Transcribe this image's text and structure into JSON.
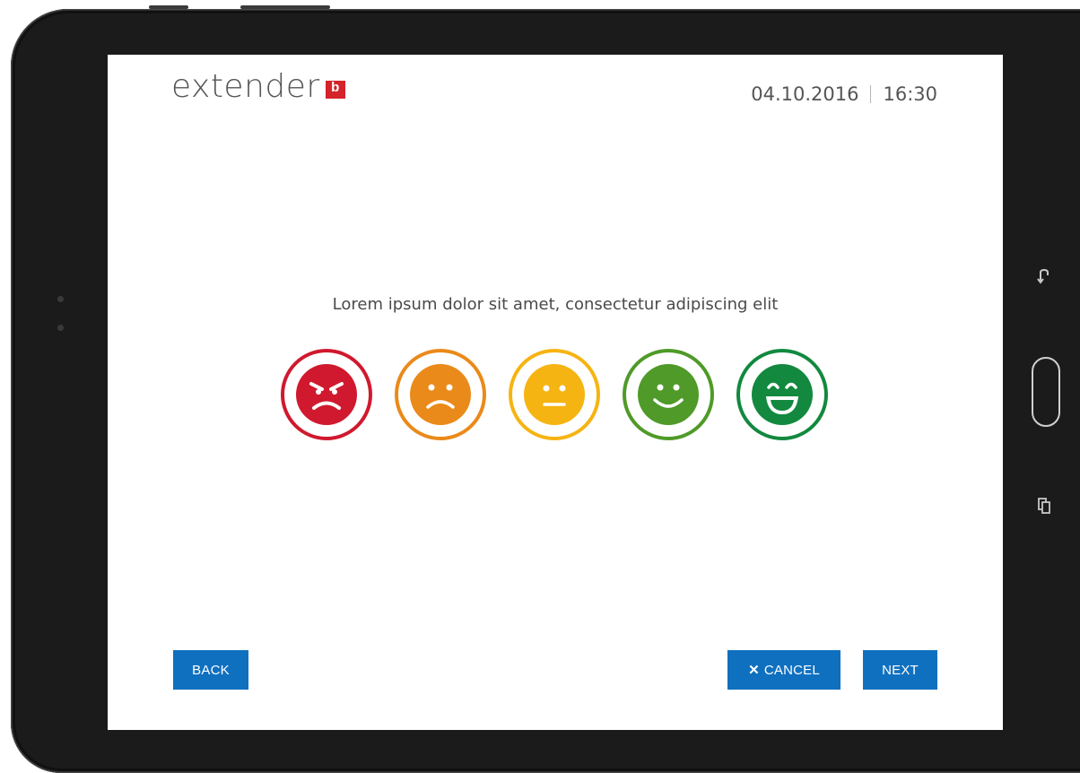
{
  "header": {
    "logo_text": "extender",
    "logo_mark": "b",
    "date": "04.10.2016",
    "time": "16:30"
  },
  "survey": {
    "question": "Lorem ipsum dolor sit amet, consectetur adipiscing elit",
    "faces": [
      {
        "name": "very-dissatisfied",
        "icon": "angry-face-icon",
        "color": "#d0192e"
      },
      {
        "name": "dissatisfied",
        "icon": "sad-face-icon",
        "color": "#ea8a1a"
      },
      {
        "name": "neutral",
        "icon": "neutral-face-icon",
        "color": "#f6b412"
      },
      {
        "name": "satisfied",
        "icon": "smile-face-icon",
        "color": "#4f9a28"
      },
      {
        "name": "very-satisfied",
        "icon": "laugh-face-icon",
        "color": "#12893f"
      }
    ]
  },
  "footer": {
    "back_label": "BACK",
    "cancel_label": "CANCEL",
    "cancel_icon": "close-icon",
    "next_label": "NEXT",
    "button_color": "#0f70c0"
  },
  "device": {
    "back_key_icon": "back-arrow-icon",
    "recent_apps_icon": "recent-apps-icon"
  }
}
